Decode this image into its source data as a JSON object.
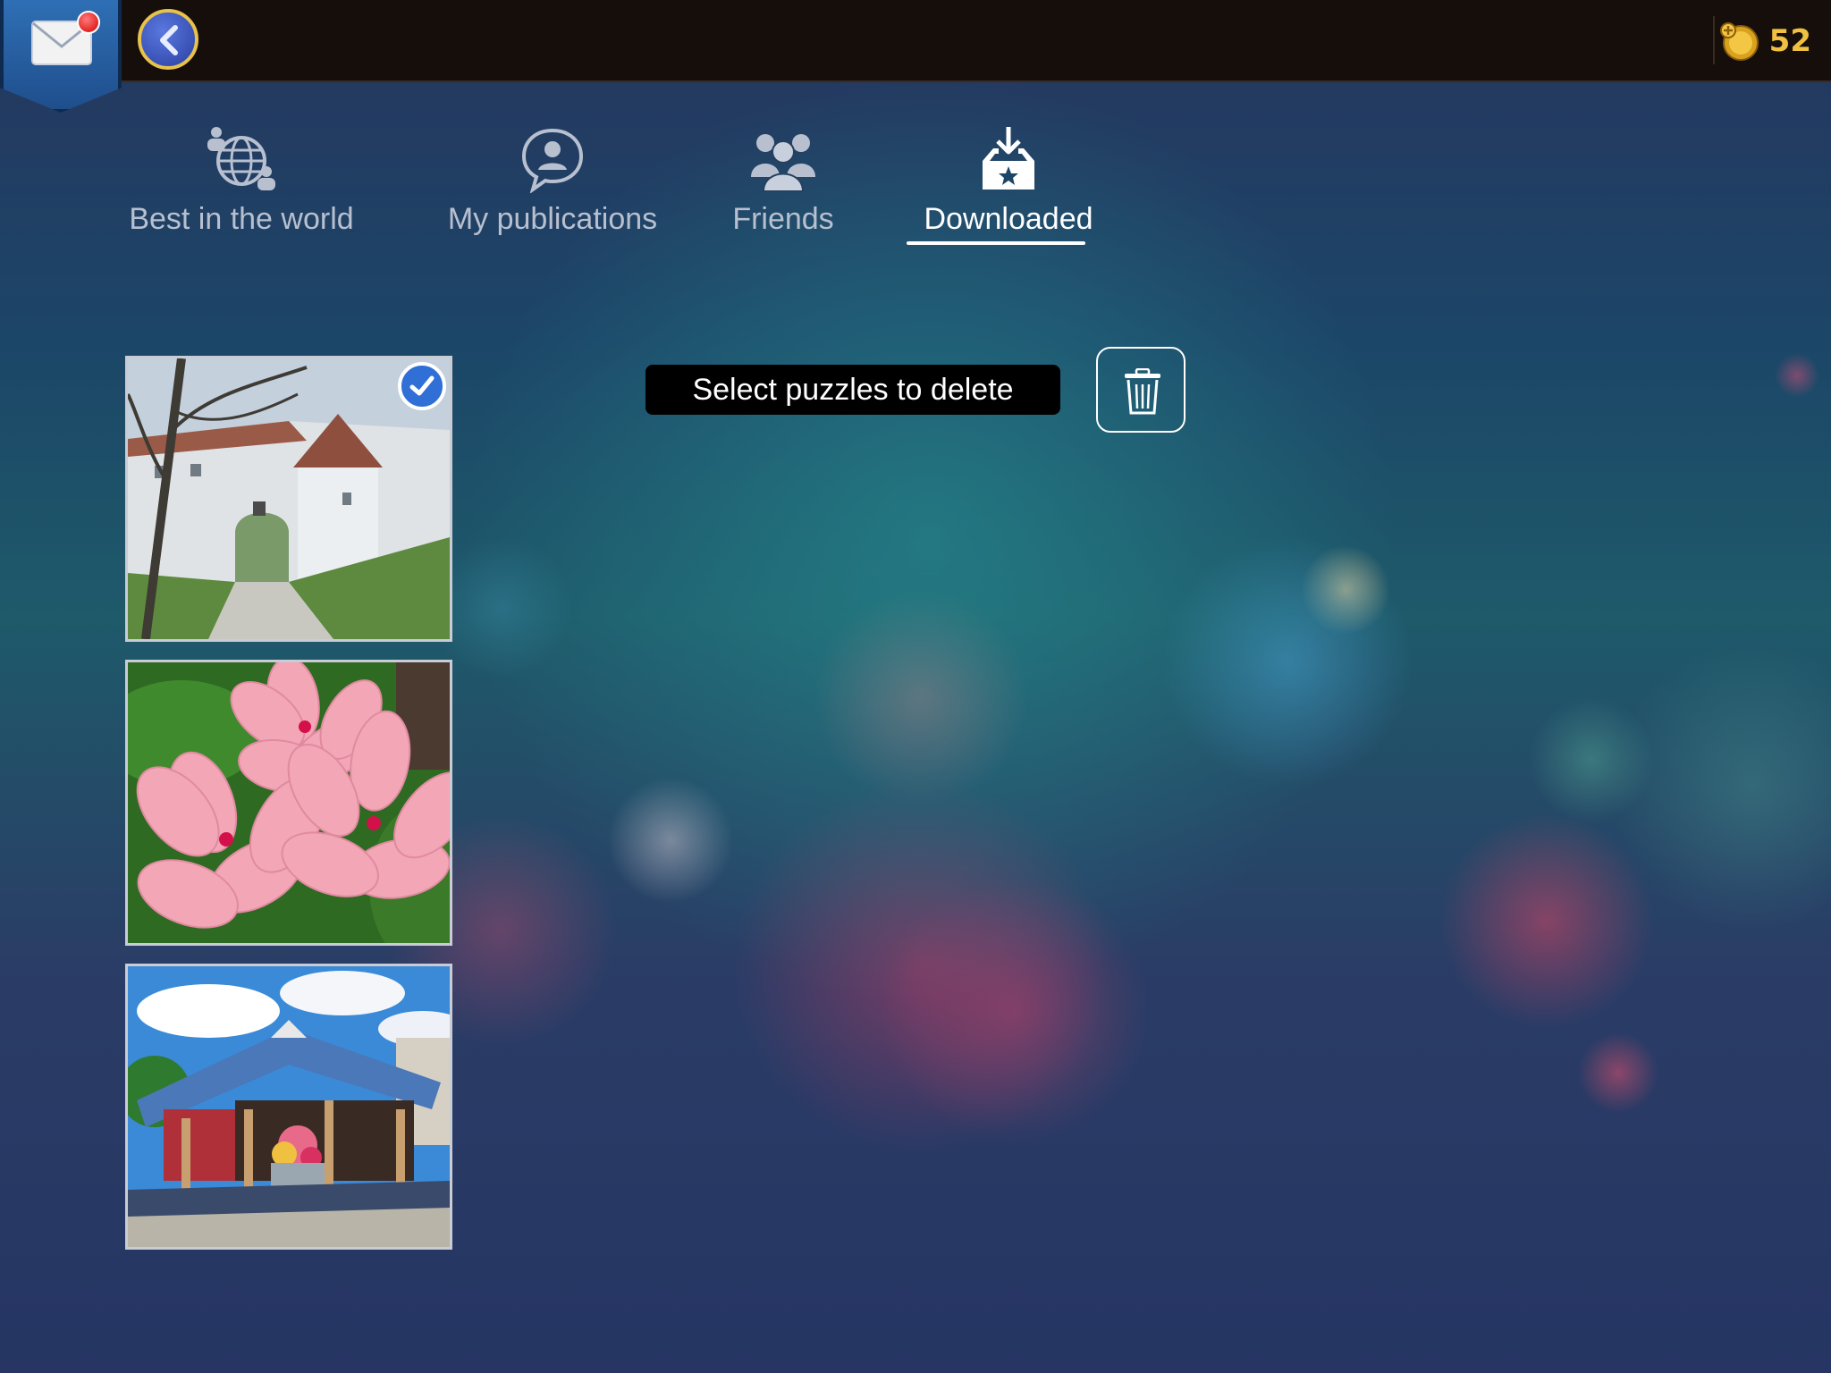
{
  "header": {
    "mail": {
      "icon": "envelope-icon",
      "has_notification": true
    },
    "back": {
      "icon": "chevron-left-icon"
    },
    "coins": {
      "icon": "coin-icon",
      "value": "52"
    }
  },
  "tabs": [
    {
      "id": "best",
      "label": "Best in the world",
      "icon": "globe-people-icon",
      "active": false
    },
    {
      "id": "mine",
      "label": "My publications",
      "icon": "user-speech-icon",
      "active": false
    },
    {
      "id": "friends",
      "label": "Friends",
      "icon": "friends-icon",
      "active": false
    },
    {
      "id": "downloaded",
      "label": "Downloaded",
      "icon": "download-box-icon",
      "active": true
    }
  ],
  "puzzles": [
    {
      "subject": "castle",
      "selected": true
    },
    {
      "subject": "pink-flowers",
      "selected": false
    },
    {
      "subject": "farm-market",
      "selected": false
    }
  ],
  "actions": {
    "select_hint": "Select puzzles to delete",
    "delete_icon": "trash-icon"
  },
  "colors": {
    "accent_gold": "#f0c040",
    "topbar": "#150e0a",
    "check_blue": "#2f6fd6"
  }
}
